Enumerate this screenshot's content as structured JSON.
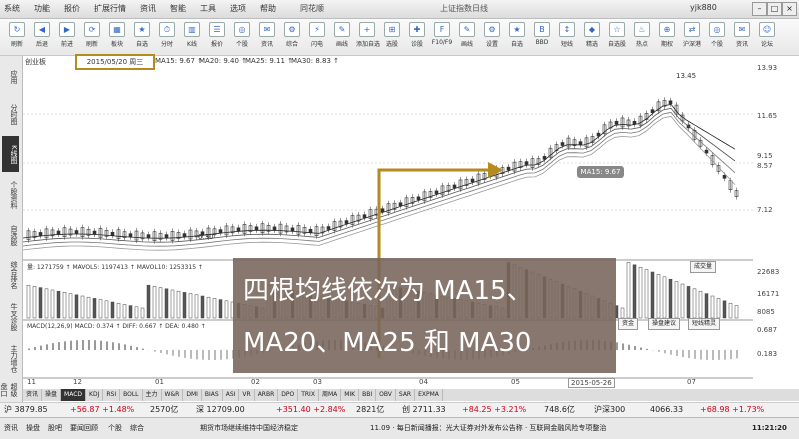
{
  "menu": [
    "系统",
    "功能",
    "报价",
    "扩展行情",
    "资讯",
    "智能",
    "工具",
    "选项",
    "帮助"
  ],
  "title": {
    "app": "同花顺",
    "center": "同花顺",
    "right": "上证指数日线"
  },
  "user": "yjk880",
  "toolbar": [
    "刷新",
    "后退",
    "前进",
    "刷新",
    "板块",
    "自选",
    "分时",
    "K线",
    "报价",
    "个股",
    "资讯",
    "综合",
    "闪电",
    "画线",
    "添加自选",
    "选股",
    "诊股",
    "F10/F9",
    "画线",
    "设置",
    "自选",
    "BBD",
    "短线",
    "精选",
    "自选股",
    "热点",
    "期权",
    "沪深港",
    "个股",
    "资讯",
    "论坛"
  ],
  "left_tabs": [
    "应用",
    "分时图",
    "K线图",
    "个股资料",
    "自选股",
    "综合排名",
    "牛叉诊股",
    "主力增仓",
    "超级盘口"
  ],
  "info_bar": {
    "stock": "创业板",
    "date": "2015/05/20 周三",
    "ma_items": [
      "MA15: 9.67 ↑",
      "MA20: 9.40 ↑",
      "MA25: 9.11 ↑",
      "MA30: 8.83 ↑"
    ]
  },
  "price_axis": [
    "13.93",
    "11.65",
    "9.15",
    "8.57",
    "7.12"
  ],
  "vol_axis": [
    "22683",
    "16171",
    "8085"
  ],
  "macd_axis": [
    "0.687",
    "0.183"
  ],
  "chart_labels": {
    "high": "13.45",
    "low": "6.30",
    "ma15_tag": "MA15: 9.67"
  },
  "vol_info": "量: 1271759 ↑  MAVOL5: 1197413 ↑  MAVOL10: 1253315 ↑",
  "macd_info": "MACD(12,26,9) MACD: 0.374 ↑ DIFF: 0.667 ↑ DEA: 0.480 ↑",
  "panel_buttons": [
    "成交量",
    "资金",
    "操盘建议",
    "短线精灵",
    "融资融券"
  ],
  "xaxis": [
    "11",
    "12",
    "01",
    "02",
    "03",
    "04",
    "05",
    "2015-05-26",
    "07"
  ],
  "indicator_tabs": [
    "资讯",
    "操盘",
    "MACD",
    "KDJ",
    "RSI",
    "BOLL",
    "主力",
    "W&R",
    "DMI",
    "BIAS",
    "ASI",
    "VR",
    "ARBR",
    "DPO",
    "TRIX",
    "周MA",
    "MIK",
    "BBI",
    "OBV",
    "SAR",
    "EXPMA"
  ],
  "annotation": {
    "line1": "四根均线依次为 MA15、",
    "line2": "MA20、MA25 和 MA30"
  },
  "status1": {
    "sh": "沪 3879.85",
    "sh_chg": "+56.87 +1.48%",
    "sh_amt": "2570亿",
    "sz": "深 12709.00",
    "sz_chg": "+351.40 +2.84%",
    "sz_amt": "2821亿",
    "cy": "创 2711.33",
    "cy_chg": "+84.25 +3.21%",
    "cy_amt": "748.6亿",
    "hs": "沪深300",
    "hs_val": "4066.33",
    "hs_chg": "+68.98 +1.73%"
  },
  "status2": {
    "tabs": [
      "资讯",
      "操盘",
      "股吧",
      "要闻回顾",
      "个股",
      "综合"
    ],
    "ticker": "期货市场继续维持中国经济稳定",
    "ticker2": "11.09 · 每日新闻播报：光大证券对外发布公告称 · 互联网金融风险专项整治",
    "time": "11:21:20"
  },
  "colors": {
    "accent_gold": "#b58a1e",
    "up": "#d0021b",
    "overlay": "#7a6458"
  }
}
